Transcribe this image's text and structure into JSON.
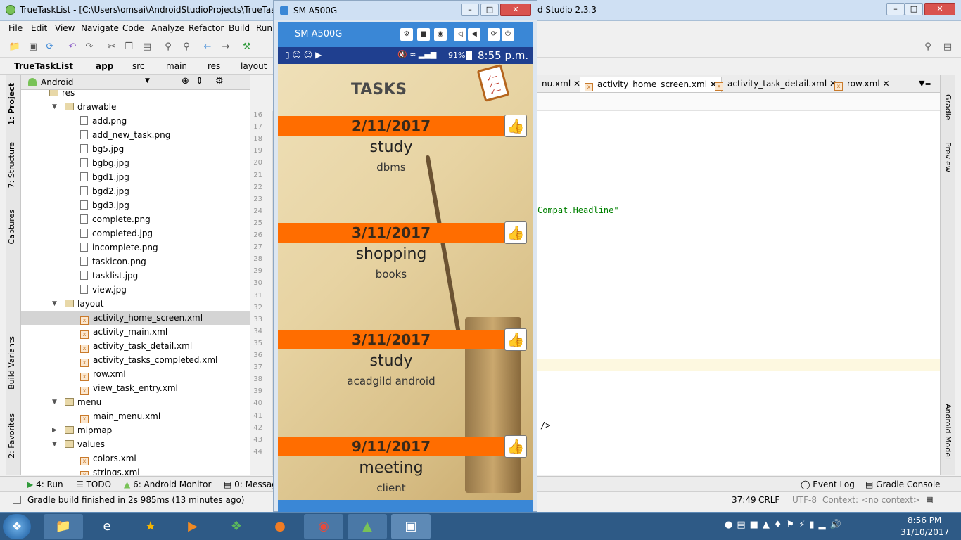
{
  "window": {
    "app_icon": "android-studio-icon",
    "title": "TrueTaskList - [C:\\Users\\omsai\\AndroidStudioProjects\\TrueTaskList]",
    "title_suffix": "d Studio 2.3.3"
  },
  "menu": [
    "File",
    "Edit",
    "View",
    "Navigate",
    "Code",
    "Analyze",
    "Refactor",
    "Build",
    "Run"
  ],
  "breadcrumb": [
    "TrueTaskList",
    "app",
    "src",
    "main",
    "res",
    "layout"
  ],
  "project_view": {
    "mode": "Android"
  },
  "tree": {
    "res": "res",
    "drawable": "drawable",
    "drawable_files": [
      "add.png",
      "add_new_task.png",
      "bg5.jpg",
      "bgbg.jpg",
      "bgd1.jpg",
      "bgd2.jpg",
      "bgd3.jpg",
      "complete.png",
      "completed.jpg",
      "incomplete.png",
      "taskicon.png",
      "tasklist.jpg",
      "view.jpg"
    ],
    "layout": "layout",
    "layout_files": [
      "activity_home_screen.xml",
      "activity_main.xml",
      "activity_task_detail.xml",
      "activity_tasks_completed.xml",
      "row.xml",
      "view_task_entry.xml"
    ],
    "menu": "menu",
    "menu_files": [
      "main_menu.xml"
    ],
    "mipmap": "mipmap",
    "values": "values",
    "values_files": [
      "colors.xml",
      "strings.xml"
    ]
  },
  "line_numbers": [
    "16",
    "17",
    "18",
    "19",
    "20",
    "21",
    "22",
    "23",
    "24",
    "25",
    "26",
    "27",
    "28",
    "29",
    "30",
    "31",
    "32",
    "33",
    "34",
    "35",
    "36",
    "37",
    "38",
    "39",
    "40",
    "41",
    "42",
    "43",
    "44"
  ],
  "editor_tabs": [
    "nu.xml",
    "activity_home_screen.xml",
    "activity_task_detail.xml",
    "row.xml"
  ],
  "editor_text": {
    "line24": "Compat.Headline\"",
    "line42": "/>"
  },
  "left_tool_windows": [
    "1: Project",
    "7: Structure",
    "Captures",
    "Build Variants",
    "2: Favorites"
  ],
  "right_tool_windows": [
    "Gradle",
    "Preview",
    "Android Model"
  ],
  "bottom_tabs": [
    "4: Run",
    "TODO",
    "6: Android Monitor",
    "0: Messag",
    "Event Log",
    "Gradle Console"
  ],
  "status": {
    "message": "Gradle build finished in 2s 985ms (13 minutes ago)",
    "position": "37:49",
    "line_sep": "CRLF",
    "encoding": "UTF-8",
    "context": "Context: <no context>"
  },
  "emulator": {
    "title": "SM A500G",
    "device": "SM A500G",
    "phone_status": {
      "battery": "91%",
      "time": "8:55 p.m."
    },
    "screen_title": "TASKS",
    "tasks": [
      {
        "date": "2/11/2017",
        "name": "study",
        "desc": "dbms"
      },
      {
        "date": "3/11/2017",
        "name": "shopping",
        "desc": "books"
      },
      {
        "date": "3/11/2017",
        "name": "study",
        "desc": "acadgild android"
      },
      {
        "date": "9/11/2017",
        "name": "meeting",
        "desc": "client"
      }
    ],
    "band_color": "#ff6d00",
    "toolbar_color": "#3a87d6"
  },
  "clock": {
    "time": "8:56 PM",
    "date": "31/10/2017"
  },
  "colors": {
    "taskbar": "#2e5a86",
    "selection": "#d4d4d4",
    "string_literal": "#008000"
  }
}
